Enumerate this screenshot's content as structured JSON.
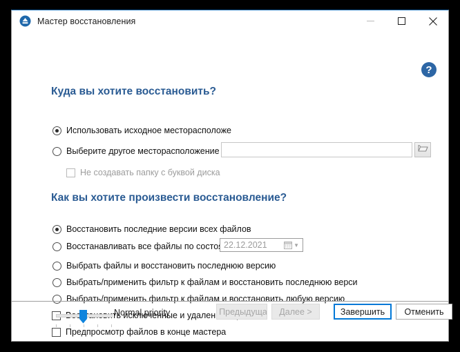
{
  "window": {
    "title": "Мастер восстановления",
    "icon": "eject-circle-icon",
    "controls": {
      "minimize": "minimize-icon",
      "maximize": "maximize-icon",
      "close": "close-icon"
    }
  },
  "help": {
    "label": "?"
  },
  "sections": [
    {
      "heading": "Куда вы хотите восстановить?",
      "options": [
        {
          "type": "radio",
          "label": "Использовать исходное месторасположе",
          "checked": true
        },
        {
          "type": "radio",
          "label": "Выберите другое месторасположение",
          "checked": false
        },
        {
          "type": "checkbox",
          "label": "Не создавать папку с буквой диска",
          "checked": false,
          "disabled": true
        }
      ]
    },
    {
      "heading": "Как вы хотите произвести восстановление?",
      "options": [
        {
          "type": "radio",
          "label": "Восстановить последние версии всех файлов",
          "checked": true
        },
        {
          "type": "radio",
          "label": "Восстанавливать все файлы по состоян",
          "checked": false
        },
        {
          "type": "radio",
          "label": "Выбрать файлы и восстановить последнюю версию",
          "checked": false
        },
        {
          "type": "radio",
          "label": "Выбрать/применить фильтр к файлам и восстановить последнюю верси",
          "checked": false
        },
        {
          "type": "radio",
          "label": "Выбрать/применить фильтр к файлам и восстановить любую версию",
          "checked": false
        },
        {
          "type": "checkbox",
          "label": "Восстановить исключенные и удаленные файлы",
          "checked": false
        },
        {
          "type": "checkbox",
          "label": "Предпросмотр файлов в конце мастера",
          "checked": false
        }
      ]
    }
  ],
  "path_field": {
    "value": "",
    "placeholder": ""
  },
  "browse_button": {
    "icon": "folder-open-icon"
  },
  "date_field": {
    "value": "22.12.2021",
    "calendar_icon": "calendar-icon",
    "arrow_icon": "chevron-down-icon"
  },
  "footer": {
    "priority_label": "Normal priority",
    "slider": {
      "ticks": 5,
      "value": 3
    },
    "buttons": {
      "previous": "< Предыдущая",
      "next": "Далее >",
      "finish": "Завершить",
      "cancel": "Отменить"
    }
  },
  "colors": {
    "accent": "#0078d7",
    "heading": "#2a5b93",
    "help_badge": "#2d66a5",
    "slider_thumb": "#0f84dd"
  }
}
